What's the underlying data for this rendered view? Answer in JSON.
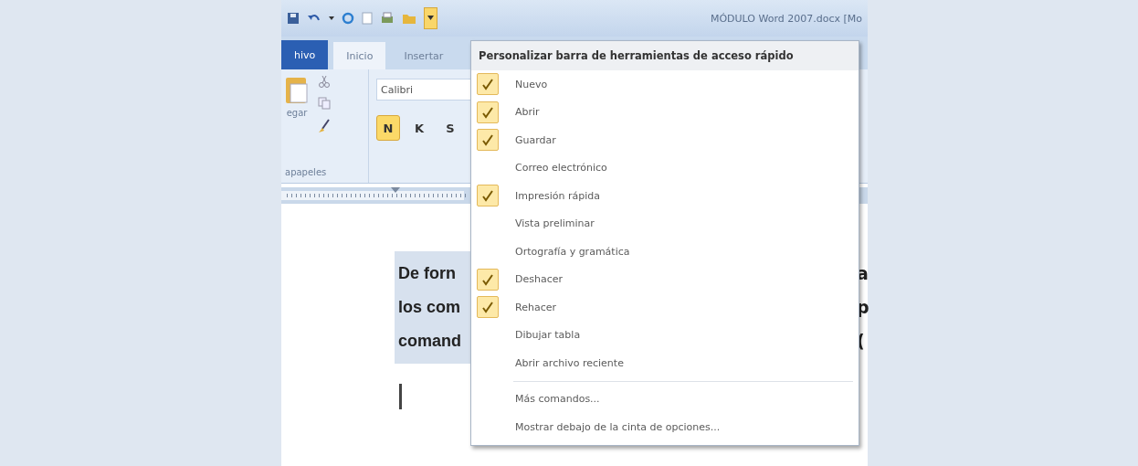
{
  "title_bar": {
    "title": "MÓDULO Word 2007.docx [Mo"
  },
  "tabs": [
    {
      "label": "hivo",
      "kind": "file"
    },
    {
      "label": "Inicio",
      "kind": "tab",
      "selected": true
    },
    {
      "label": "Insertar",
      "kind": "tab",
      "selected": false
    }
  ],
  "ribbon": {
    "paste_label": "egar",
    "group_label": "apapeles",
    "font_name": "Calibri",
    "format_buttons": [
      {
        "label": "N",
        "on": true
      },
      {
        "label": "K",
        "on": false
      },
      {
        "label": "S",
        "on": false
      }
    ]
  },
  "document": {
    "lines": [
      "De forn",
      "los com",
      "comand"
    ],
    "right_edge": [
      "a",
      "p",
      "("
    ]
  },
  "menu": {
    "title": "Personalizar barra de herramientas de acceso rápido",
    "items": [
      {
        "label": "Nuevo",
        "checked": true
      },
      {
        "label": "Abrir",
        "checked": true
      },
      {
        "label": "Guardar",
        "checked": true
      },
      {
        "label": "Correo electrónico",
        "checked": false
      },
      {
        "label": "Impresión rápida",
        "checked": true
      },
      {
        "label": "Vista preliminar",
        "checked": false
      },
      {
        "label": "Ortografía y gramática",
        "checked": false
      },
      {
        "label": "Deshacer",
        "checked": true
      },
      {
        "label": "Rehacer",
        "checked": true
      },
      {
        "label": "Dibujar tabla",
        "checked": false
      },
      {
        "label": "Abrir archivo reciente",
        "checked": false
      }
    ],
    "footer_items": [
      "Más comandos...",
      "Mostrar debajo de la cinta de opciones..."
    ]
  }
}
